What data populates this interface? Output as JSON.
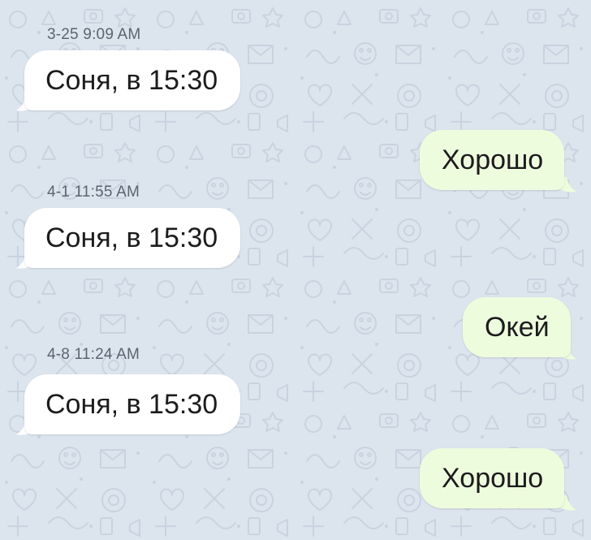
{
  "chat": {
    "background_color": "#dce4ee",
    "incoming_bubble_color": "#ffffff",
    "outgoing_bubble_color": "#eefcde",
    "messages": [
      {
        "direction": "incoming",
        "timestamp": "3-25 9:09 AM",
        "text": "Соня, в 15:30"
      },
      {
        "direction": "outgoing",
        "text": "Хорошо"
      },
      {
        "direction": "incoming",
        "timestamp": "4-1 11:55 AM",
        "text": "Соня, в 15:30"
      },
      {
        "direction": "outgoing",
        "text": "Окей"
      },
      {
        "direction": "incoming",
        "timestamp": "4-8 11:24 AM",
        "text": "Соня, в 15:30"
      },
      {
        "direction": "outgoing",
        "text": "Хорошо"
      }
    ]
  }
}
